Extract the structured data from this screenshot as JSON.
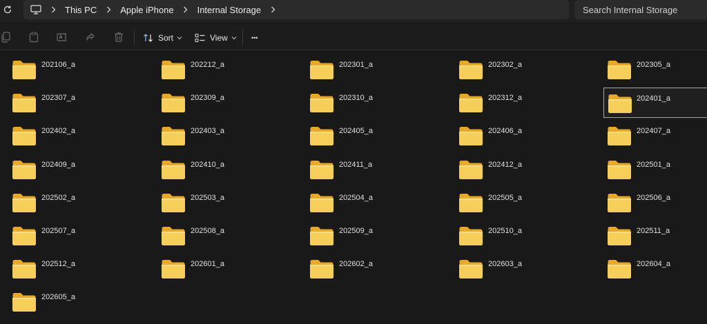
{
  "address_bar": {
    "breadcrumb": [
      "This PC",
      "Apple iPhone",
      "Internal Storage"
    ],
    "search_placeholder": "Search Internal Storage"
  },
  "command_bar": {
    "sort_label": "Sort",
    "view_label": "View",
    "more_label": "•••"
  },
  "folders": [
    "202106_a",
    "202212_a",
    "202301_a",
    "202302_a",
    "202305_a",
    "202307_a",
    "202309_a",
    "202310_a",
    "202312_a",
    "202401_a",
    "202402_a",
    "202403_a",
    "202405_a",
    "202406_a",
    "202407_a",
    "202409_a",
    "202410_a",
    "202411_a",
    "202412_a",
    "202501_a",
    "202502_a",
    "202503_a",
    "202504_a",
    "202505_a",
    "202506_a",
    "202507_a",
    "202508_a",
    "202509_a",
    "202510_a",
    "202511_a",
    "202512_a",
    "202601_a",
    "202602_a",
    "202603_a",
    "202604_a",
    "202605_a"
  ],
  "selected_folder": "202401_a",
  "colors": {
    "background": "#191919",
    "folder_back": "#e8a92b",
    "folder_front": "#f6cf5a",
    "selection_border": "#a8a8a8"
  }
}
